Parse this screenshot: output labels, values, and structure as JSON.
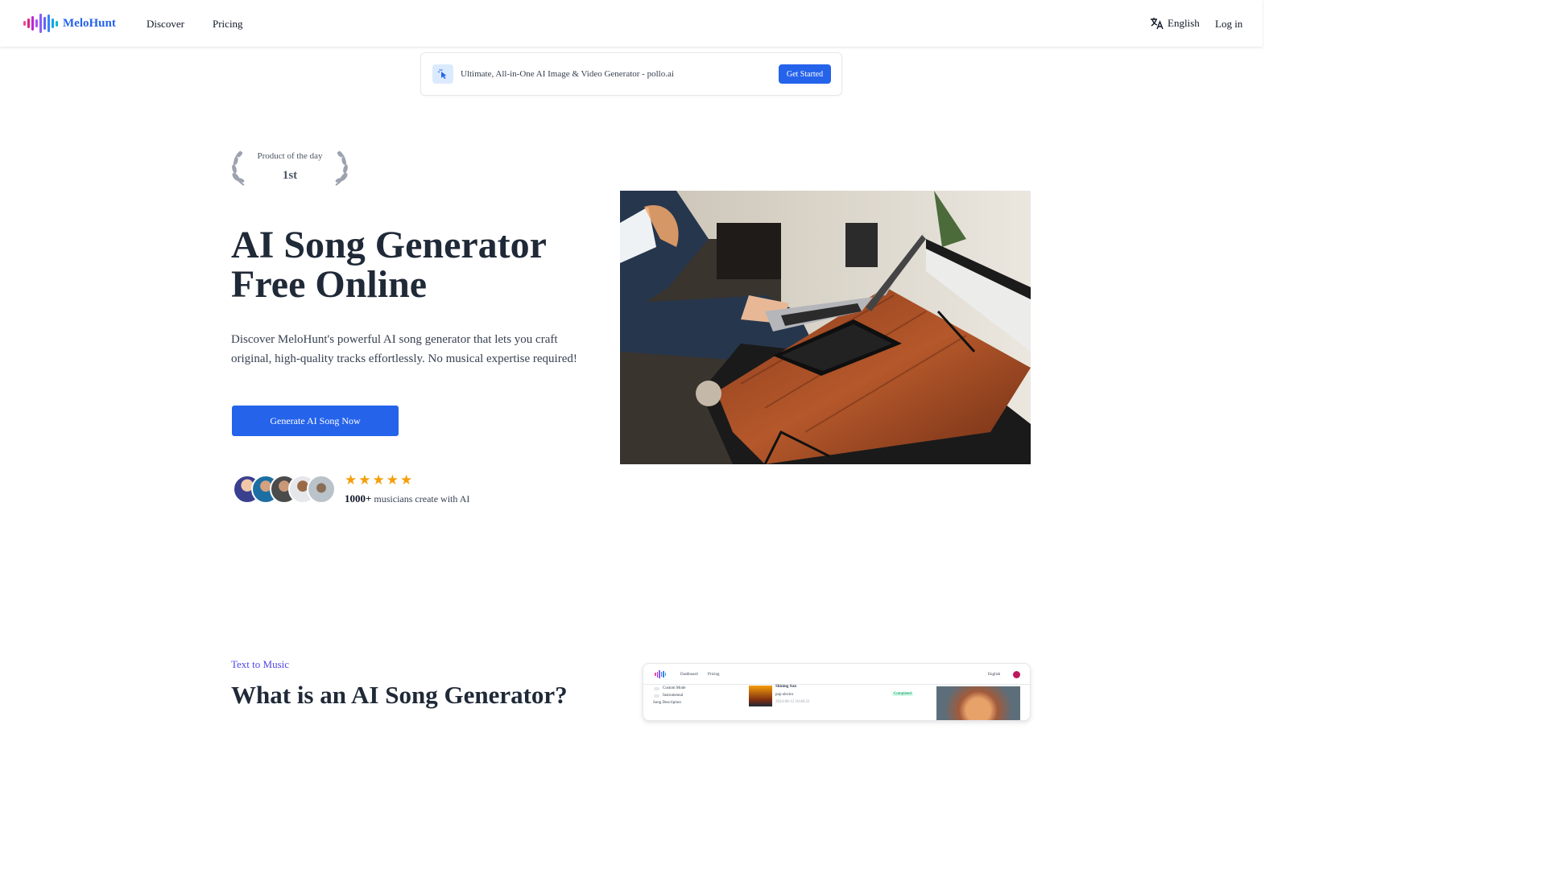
{
  "header": {
    "brand": "MeloHunt",
    "nav": [
      {
        "label": "Discover"
      },
      {
        "label": "Pricing"
      }
    ],
    "language": "English",
    "login": "Log in"
  },
  "promo": {
    "text": "Ultimate, All-in-One AI Image & Video Generator - pollo.ai",
    "button": "Get Started"
  },
  "badge": {
    "title": "Product of the day",
    "rank": "1st"
  },
  "hero": {
    "title_line1": "AI Song Generator",
    "title_line2": "Free Online",
    "description": "Discover MeloHunt's powerful AI song generator that lets you craft original, high-quality tracks effortlessly. No musical expertise required!",
    "cta": "Generate AI Song Now",
    "rating_stars": 5,
    "musicians_count": "1000+",
    "musicians_text": "musicians create with AI"
  },
  "section": {
    "tag": "Text to Music",
    "title": "What is an AI Song Generator?"
  },
  "app_preview": {
    "nav": [
      "Dashboard",
      "Pricing"
    ],
    "language": "English",
    "options": [
      "Custom Mode",
      "Instrumental"
    ],
    "song_description_label": "Song Description",
    "song_title": "Shining Sun",
    "song_genre": "pop electro",
    "song_status": "Completed",
    "song_date": "2024-06-12 10:48:32"
  },
  "colors": {
    "accent": "#2563eb",
    "tag": "#4f46e5",
    "star": "#f59e0b"
  },
  "icons": [
    "sound-wave-logo-icon",
    "translate-icon",
    "pointer-click-icon",
    "laurel-left-icon",
    "laurel-right-icon",
    "star-icon"
  ]
}
